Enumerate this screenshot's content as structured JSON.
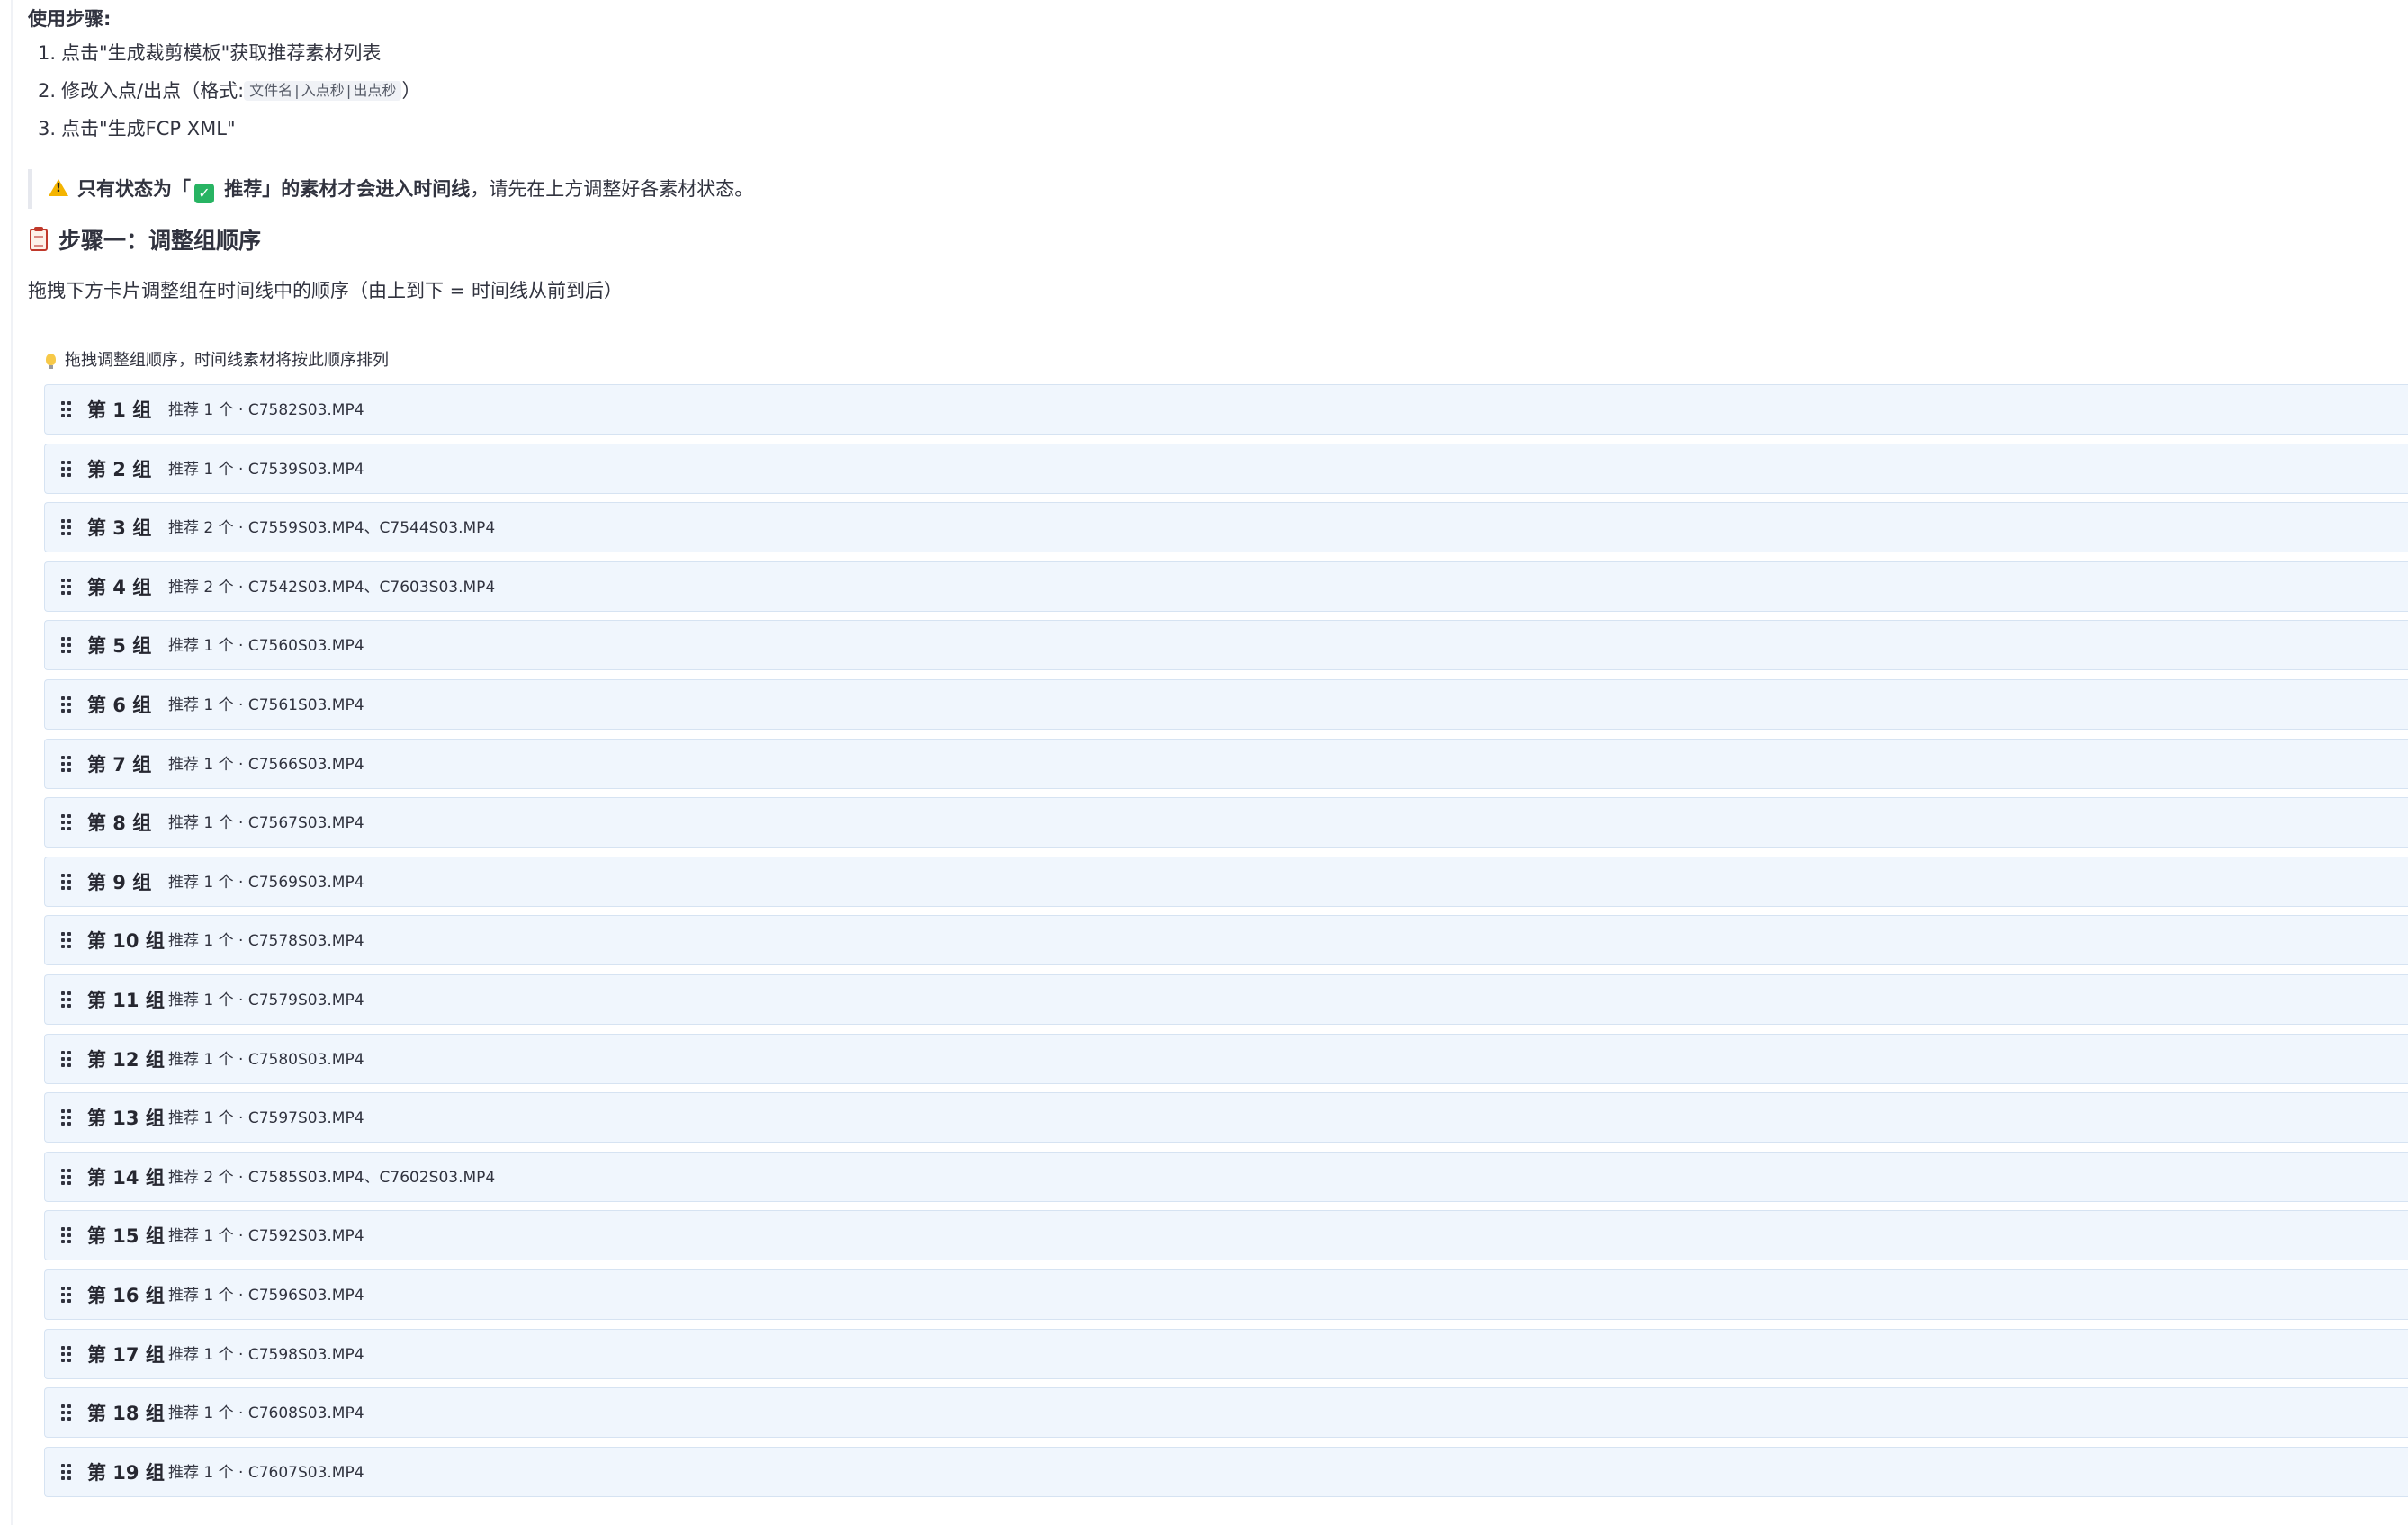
{
  "instructions": {
    "title": "使用步骤:",
    "steps": [
      {
        "num": "1.",
        "text": "点击\"生成裁剪模板\"获取推荐素材列表"
      },
      {
        "num": "2.",
        "text_before": "修改入点/出点（格式:",
        "code": "文件名|入点秒|出点秒",
        "text_after": "）"
      },
      {
        "num": "3.",
        "text": "点击\"生成FCP XML\""
      }
    ]
  },
  "warning": {
    "icon": "warning-icon",
    "bold_before": "只有状态为「",
    "check_icon": "✓",
    "bold_after": " 推荐」的素材才会进入时间线",
    "normal": "，请先在上方调整好各素材状态。"
  },
  "section": {
    "icon": "clipboard-icon",
    "heading": "步骤一：调整组顺序",
    "description": "拖拽下方卡片调整组在时间线中的顺序（由上到下 = 时间线从前到后）"
  },
  "tip": {
    "icon": "lightbulb-icon",
    "text": "拖拽调整组顺序，时间线素材将按此顺序排列"
  },
  "groups": [
    {
      "name": "第 1 组",
      "info": "推荐 1 个 · C7582S03.MP4"
    },
    {
      "name": "第 2 组",
      "info": "推荐 1 个 · C7539S03.MP4"
    },
    {
      "name": "第 3 组",
      "info": "推荐 2 个 · C7559S03.MP4、C7544S03.MP4"
    },
    {
      "name": "第 4 组",
      "info": "推荐 2 个 · C7542S03.MP4、C7603S03.MP4"
    },
    {
      "name": "第 5 组",
      "info": "推荐 1 个 · C7560S03.MP4"
    },
    {
      "name": "第 6 组",
      "info": "推荐 1 个 · C7561S03.MP4"
    },
    {
      "name": "第 7 组",
      "info": "推荐 1 个 · C7566S03.MP4"
    },
    {
      "name": "第 8 组",
      "info": "推荐 1 个 · C7567S03.MP4"
    },
    {
      "name": "第 9 组",
      "info": "推荐 1 个 · C7569S03.MP4"
    },
    {
      "name": "第 10 组",
      "info": "推荐 1 个 · C7578S03.MP4"
    },
    {
      "name": "第 11 组",
      "info": "推荐 1 个 · C7579S03.MP4"
    },
    {
      "name": "第 12 组",
      "info": "推荐 1 个 · C7580S03.MP4"
    },
    {
      "name": "第 13 组",
      "info": "推荐 1 个 · C7597S03.MP4"
    },
    {
      "name": "第 14 组",
      "info": "推荐 2 个 · C7585S03.MP4、C7602S03.MP4"
    },
    {
      "name": "第 15 组",
      "info": "推荐 1 个 · C7592S03.MP4"
    },
    {
      "name": "第 16 组",
      "info": "推荐 1 个 · C7596S03.MP4"
    },
    {
      "name": "第 17 组",
      "info": "推荐 1 个 · C7598S03.MP4"
    },
    {
      "name": "第 18 组",
      "info": "推荐 1 个 · C7608S03.MP4"
    },
    {
      "name": "第 19 组",
      "info": "推荐 1 个 · C7607S03.MP4"
    }
  ],
  "colors": {
    "card_background": "#f0f6fd",
    "card_border": "#d6e3f2",
    "text": "#31333f"
  }
}
